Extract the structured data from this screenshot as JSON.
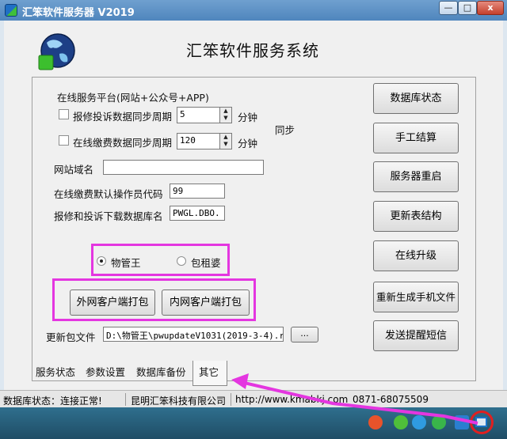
{
  "window": {
    "title": "汇笨软件服务器 V2019",
    "min_label": "—",
    "max_label": "□",
    "close_label": "x"
  },
  "header": {
    "title": "汇笨软件服务系统"
  },
  "settings": {
    "section_label": "在线服务平台(网站+公众号+APP)",
    "repair_sync_label": "报修投诉数据同步周期",
    "repair_sync_value": "5",
    "repair_sync_unit": "分钟",
    "payment_sync_label": "在线缴费数据同步周期",
    "payment_sync_value": "120",
    "payment_sync_unit": "分钟",
    "sync_label": "同步",
    "domain_label": "网站域名",
    "domain_value": "",
    "operator_label": "在线缴费默认操作员代码",
    "operator_value": "99",
    "dbname_label": "报修和投诉下载数据库名",
    "dbname_value": "PWGL.DBO."
  },
  "product": {
    "options": [
      "物管王",
      "包租婆"
    ],
    "selected": "物管王"
  },
  "packaging": {
    "external_label": "外网客户端打包",
    "internal_label": "内网客户端打包",
    "update_label": "更新包文件",
    "update_value": "D:\\物管王\\pwupdateV1031(2019-3-4).r",
    "browse_label": "..."
  },
  "side_buttons": [
    "数据库状态",
    "手工结算",
    "服务器重启",
    "更新表结构",
    "在线升级",
    "重新生成手机文件",
    "发送提醒短信"
  ],
  "tabs": [
    "服务状态",
    "参数设置",
    "数据库备份",
    "其它"
  ],
  "active_tab": "其它",
  "statusbar": {
    "db_status": "数据库状态：连接正常!",
    "company": "昆明汇笨科技有限公司",
    "website": "http://www.kmabkj.com",
    "phone": "0871-68075509"
  },
  "colors": {
    "highlight": "#e436e0",
    "titlebar": "#5a8fc4",
    "taskbar": "#2a5f7a"
  }
}
